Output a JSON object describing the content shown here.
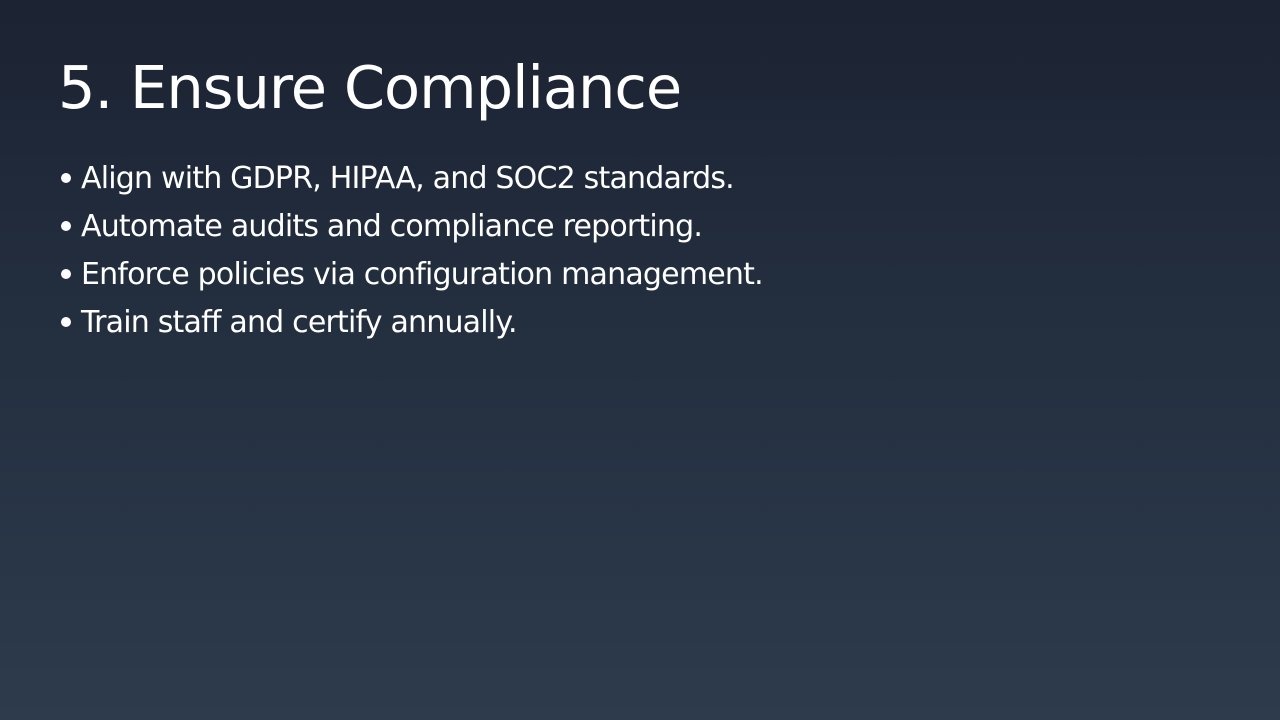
{
  "slide": {
    "title": "5. Ensure Compliance",
    "bullets": [
      "Align with GDPR, HIPAA, and SOC2 standards.",
      "Automate audits and compliance reporting.",
      "Enforce policies via configuration management.",
      "Train staff and certify annually."
    ]
  },
  "colors": {
    "background_top": "#1c2333",
    "background_bottom": "#2d3b4d",
    "text": "#ffffff"
  }
}
